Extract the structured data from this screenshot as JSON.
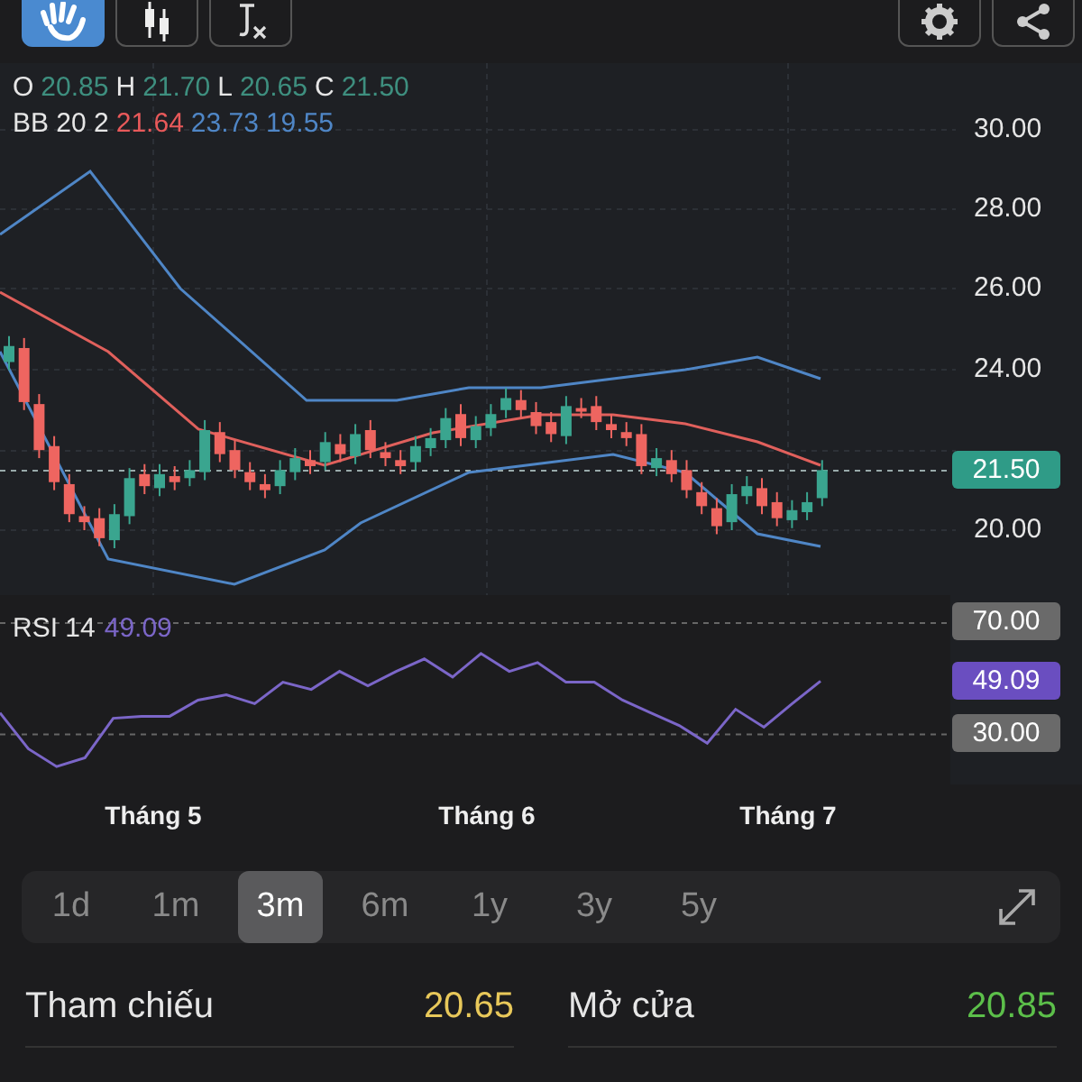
{
  "toolbar": {
    "tools": [
      {
        "kind": "hand",
        "selected": true
      },
      {
        "kind": "candles",
        "selected": false
      },
      {
        "kind": "fx",
        "selected": false
      }
    ]
  },
  "ohlc": [
    {
      "label": "O",
      "value": "20.85"
    },
    {
      "label": "H",
      "value": "21.70"
    },
    {
      "label": "L",
      "value": "20.65"
    },
    {
      "label": "C",
      "value": "21.50"
    }
  ],
  "bb": {
    "label": "BB 20 2",
    "values": [
      {
        "value": "21.64",
        "color": "#e8595a"
      },
      {
        "value": "23.73",
        "color": "#4f86c6"
      },
      {
        "value": "19.55",
        "color": "#4f86c6"
      }
    ]
  },
  "price_axis": [
    "30.00",
    "28.00",
    "26.00",
    "24.00",
    "20.00"
  ],
  "last_price": "21.50",
  "rsi": {
    "label": "RSI 14",
    "value": "49.09",
    "badge_value": "49.09",
    "chart_data": {
      "type": "line",
      "ylim": [
        12,
        80
      ],
      "yticks": [
        {
          "value": 70,
          "label": "70.00"
        },
        {
          "value": 30,
          "label": "30.00"
        }
      ],
      "series": [
        {
          "color": "#7b66c8",
          "values": [
            37.7,
            24.8,
            18.4,
            21.6,
            35.8,
            36.5,
            36.5,
            42.3,
            44.2,
            41.0,
            48.7,
            46.1,
            52.6,
            47.4,
            52.6,
            57.1,
            50.6,
            59.0,
            52.6,
            55.8,
            48.7,
            48.7,
            42.3,
            37.7,
            33.2,
            26.8,
            39.0,
            32.6,
            41.0,
            49.1
          ]
        }
      ]
    }
  },
  "months": [
    "Tháng 5",
    "Tháng 6",
    "Tháng 7"
  ],
  "ranges": [
    {
      "label": "1d",
      "selected": false
    },
    {
      "label": "1m",
      "selected": false
    },
    {
      "label": "3m",
      "selected": true
    },
    {
      "label": "6m",
      "selected": false
    },
    {
      "label": "1y",
      "selected": false
    },
    {
      "label": "3y",
      "selected": false
    },
    {
      "label": "5y",
      "selected": false
    }
  ],
  "stats": [
    {
      "label": "Tham chiếu",
      "value": "20.65",
      "kind": "reference"
    },
    {
      "label": "Mở cửa",
      "value": "20.85",
      "kind": "up"
    }
  ]
}
